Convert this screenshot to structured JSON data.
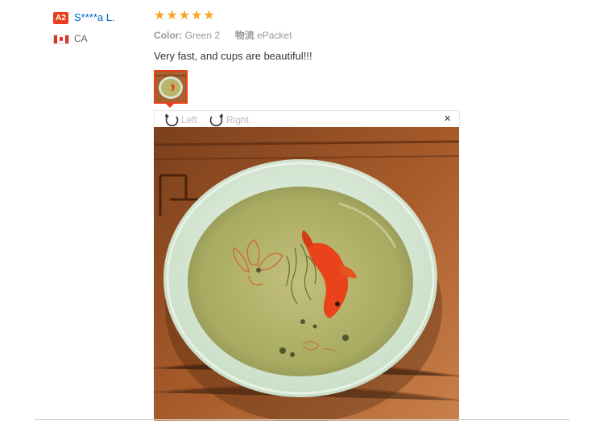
{
  "reviewer": {
    "level_badge": "A2",
    "name": "S****a L.",
    "country": "CA",
    "flag_icon": "canada-flag-icon"
  },
  "review": {
    "rating": 5,
    "stars": [
      "★",
      "★",
      "★",
      "★",
      "★"
    ],
    "star_color": "#f5a623",
    "color_label": "Color:",
    "color_value": "Green 2",
    "shipping_label": "物流",
    "shipping_value": "ePacket",
    "text": "Very fast, and cups are beautiful!!!"
  },
  "viewer": {
    "rotate_left_label": "Left",
    "rotate_right_label": "Right",
    "close_glyph": "×",
    "rotate_left_icon": "rotate-left-icon",
    "rotate_right_icon": "rotate-right-icon",
    "close_icon": "close-icon"
  },
  "colors": {
    "accent": "#e8401c",
    "link": "#0066cc"
  }
}
